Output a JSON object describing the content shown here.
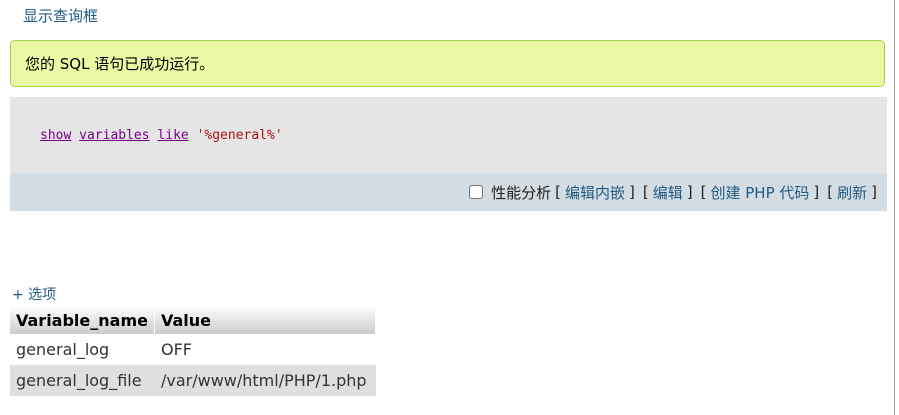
{
  "header": {
    "show_query_box_label": "显示查询框"
  },
  "message": {
    "success_text": "您的 SQL 语句已成功运行。"
  },
  "sql": {
    "kw_show": "show",
    "kw_variables": "variables",
    "kw_like": "like",
    "pattern": "'%general%'"
  },
  "toolbar": {
    "profiling_label": "性能分析",
    "edit_inline": "编辑内嵌",
    "edit": "编辑",
    "create_php": "创建 PHP 代码",
    "refresh": "刷新",
    "open_bracket": "[",
    "close_bracket": "]"
  },
  "options": {
    "label": "+ 选项"
  },
  "table": {
    "headers": [
      "Variable_name",
      "Value"
    ],
    "rows": [
      [
        "general_log",
        "OFF"
      ],
      [
        "general_log_file",
        "/var/www/html/PHP/1.php"
      ]
    ]
  },
  "colors": {
    "link": "#235a81",
    "success_bg": "#ebf8a4",
    "success_border": "#a2d246",
    "code_bg": "#e5e5e5",
    "toolbar_bg": "#d3dce3",
    "keyword": "#770088",
    "string": "#aa1111"
  }
}
